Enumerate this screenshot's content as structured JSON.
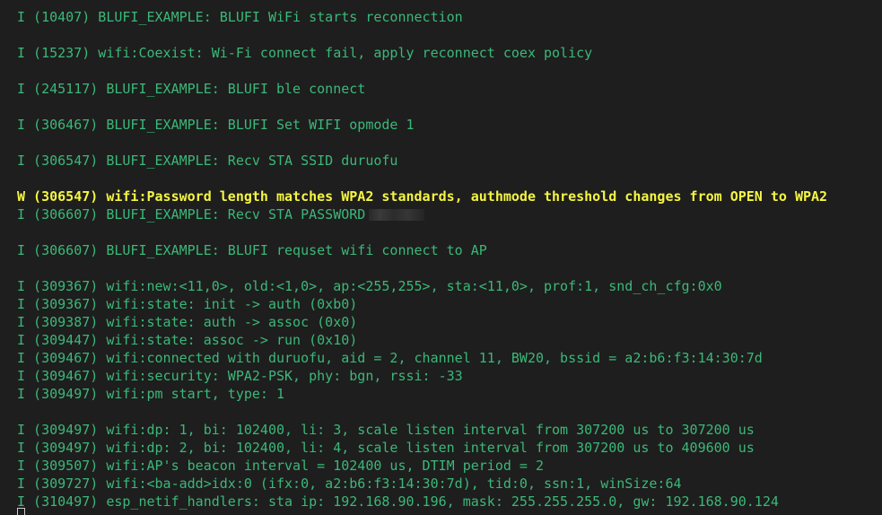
{
  "terminal": {
    "lines": [
      {
        "level": "info",
        "text": "I (10407) BLUFI_EXAMPLE: BLUFI WiFi starts reconnection"
      },
      {
        "level": "blank",
        "text": ""
      },
      {
        "level": "info",
        "text": "I (15237) wifi:Coexist: Wi-Fi connect fail, apply reconnect coex policy"
      },
      {
        "level": "blank",
        "text": ""
      },
      {
        "level": "info",
        "text": "I (245117) BLUFI_EXAMPLE: BLUFI ble connect"
      },
      {
        "level": "blank",
        "text": ""
      },
      {
        "level": "info",
        "text": "I (306467) BLUFI_EXAMPLE: BLUFI Set WIFI opmode 1"
      },
      {
        "level": "blank",
        "text": ""
      },
      {
        "level": "info",
        "text": "I (306547) BLUFI_EXAMPLE: Recv STA SSID duruofu"
      },
      {
        "level": "blank",
        "text": ""
      },
      {
        "level": "warn",
        "text": "W (306547) wifi:Password length matches WPA2 standards, authmode threshold changes from OPEN to WPA2"
      },
      {
        "level": "info",
        "text": "I (306607) BLUFI_EXAMPLE: Recv STA PASSWORD",
        "redacted": true
      },
      {
        "level": "blank",
        "text": ""
      },
      {
        "level": "info",
        "text": "I (306607) BLUFI_EXAMPLE: BLUFI requset wifi connect to AP"
      },
      {
        "level": "blank",
        "text": ""
      },
      {
        "level": "info",
        "text": "I (309367) wifi:new:<11,0>, old:<1,0>, ap:<255,255>, sta:<11,0>, prof:1, snd_ch_cfg:0x0"
      },
      {
        "level": "info",
        "text": "I (309367) wifi:state: init -> auth (0xb0)"
      },
      {
        "level": "info",
        "text": "I (309387) wifi:state: auth -> assoc (0x0)"
      },
      {
        "level": "info",
        "text": "I (309447) wifi:state: assoc -> run (0x10)"
      },
      {
        "level": "info",
        "text": "I (309467) wifi:connected with duruofu, aid = 2, channel 11, BW20, bssid = a2:b6:f3:14:30:7d"
      },
      {
        "level": "info",
        "text": "I (309467) wifi:security: WPA2-PSK, phy: bgn, rssi: -33"
      },
      {
        "level": "info",
        "text": "I (309497) wifi:pm start, type: 1"
      },
      {
        "level": "blank",
        "text": ""
      },
      {
        "level": "info",
        "text": "I (309497) wifi:dp: 1, bi: 102400, li: 3, scale listen interval from 307200 us to 307200 us"
      },
      {
        "level": "info",
        "text": "I (309497) wifi:dp: 2, bi: 102400, li: 4, scale listen interval from 307200 us to 409600 us"
      },
      {
        "level": "info",
        "text": "I (309507) wifi:AP's beacon interval = 102400 us, DTIM period = 2"
      },
      {
        "level": "info",
        "text": "I (309727) wifi:<ba-add>idx:0 (ifx:0, a2:b6:f3:14:30:7d), tid:0, ssn:1, winSize:64"
      },
      {
        "level": "info",
        "text": "I (310497) esp_netif_handlers: sta ip: 192.168.90.196, mask: 255.255.255.0, gw: 192.168.90.124"
      }
    ]
  },
  "colors": {
    "background": "#1e1e1e",
    "info": "#3bb878",
    "warn": "#f5f543"
  }
}
